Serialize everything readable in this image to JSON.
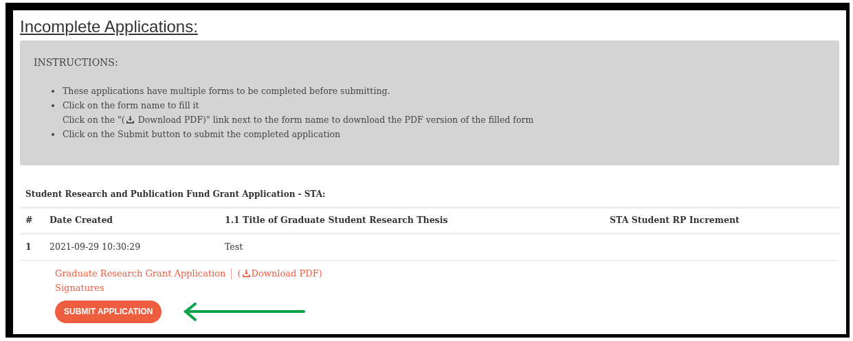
{
  "title": "Incomplete Applications:",
  "instructions": {
    "heading": "INSTRUCTIONS:",
    "items": [
      {
        "lines": [
          {
            "text": "These applications have multiple forms to be completed before submitting."
          }
        ]
      },
      {
        "lines": [
          {
            "text": "Click on the form name to fill it"
          },
          {
            "before": "Click on the \"(",
            "text": " Download PDF)\" link next to the form name to download the PDF version of the filled form"
          }
        ]
      },
      {
        "lines": [
          {
            "text": "Click on the Submit button to submit the completed application"
          }
        ]
      }
    ]
  },
  "section_title": "Student Research and Publication Fund Grant Application - STA:",
  "table": {
    "columns": [
      "#",
      "Date Created",
      "1.1 Title of Graduate Student Research Thesis",
      "STA Student RP Increment"
    ],
    "rows": [
      [
        "1",
        "2021-09-29 10:30:29",
        "Test"
      ]
    ]
  },
  "forms": [
    {
      "label": "Graduate Research Grant Application",
      "download": {
        "open": "(",
        "label": "Download PDF)"
      }
    },
    {
      "label": "Signatures"
    }
  ],
  "submit_button": "SUBMIT APPLICATION"
}
